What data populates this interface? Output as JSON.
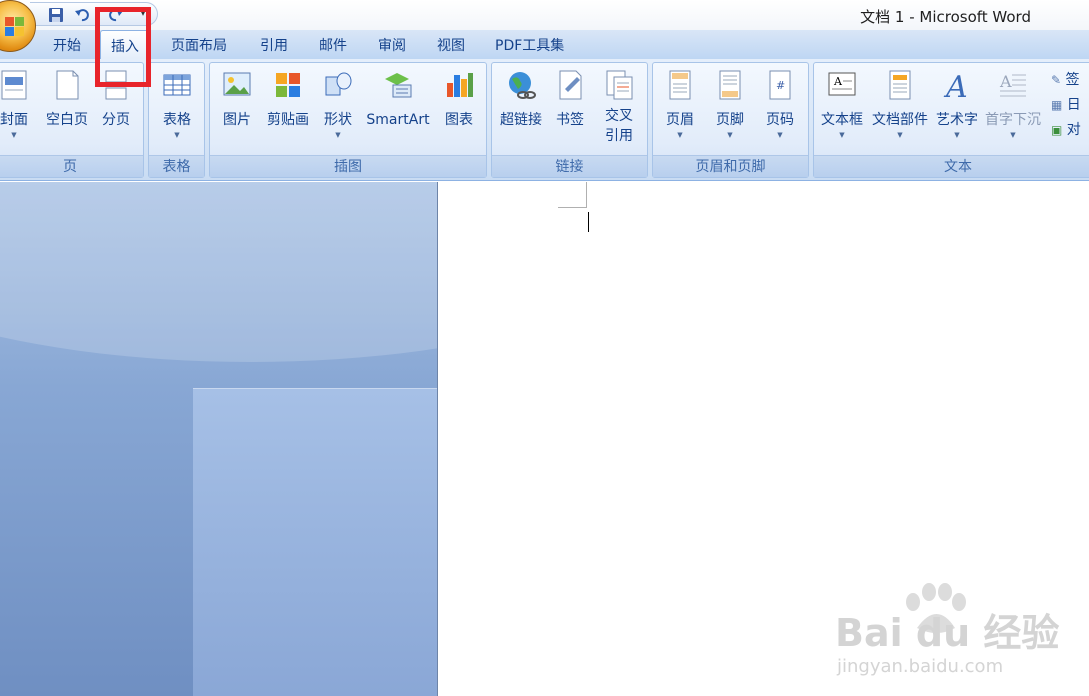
{
  "window": {
    "title": "文档 1 - Microsoft Word"
  },
  "tabs": [
    {
      "label": "开始",
      "active": false
    },
    {
      "label": "插入",
      "active": true
    },
    {
      "label": "页面布局",
      "active": false
    },
    {
      "label": "引用",
      "active": false
    },
    {
      "label": "邮件",
      "active": false
    },
    {
      "label": "审阅",
      "active": false
    },
    {
      "label": "视图",
      "active": false
    },
    {
      "label": "PDF工具集",
      "active": false
    }
  ],
  "ribbon": {
    "groups": {
      "pages": {
        "label": "页",
        "cover": "封面",
        "blank": "空白页",
        "break": "分页"
      },
      "tables": {
        "label": "表格",
        "table": "表格"
      },
      "illustrations": {
        "label": "插图",
        "picture": "图片",
        "clipart": "剪贴画",
        "shapes": "形状",
        "smartart": "SmartArt",
        "chart": "图表"
      },
      "links": {
        "label": "链接",
        "hyperlink": "超链接",
        "bookmark": "书签",
        "crossref_line1": "交叉",
        "crossref_line2": "引用"
      },
      "header_footer": {
        "label": "页眉和页脚",
        "header": "页眉",
        "footer": "页脚",
        "page_number": "页码"
      },
      "text": {
        "label": "文本",
        "textbox": "文本框",
        "quick_parts": "文档部件",
        "wordart": "艺术字",
        "dropcap": "首字下沉",
        "signature": "签",
        "datetime": "日",
        "object": "对"
      }
    }
  },
  "watermark": {
    "brand_text": "Bai  du 经验",
    "url": "jingyan.baidu.com"
  },
  "colors": {
    "highlight": "#e8242b",
    "ribbon_text": "#15428b"
  }
}
